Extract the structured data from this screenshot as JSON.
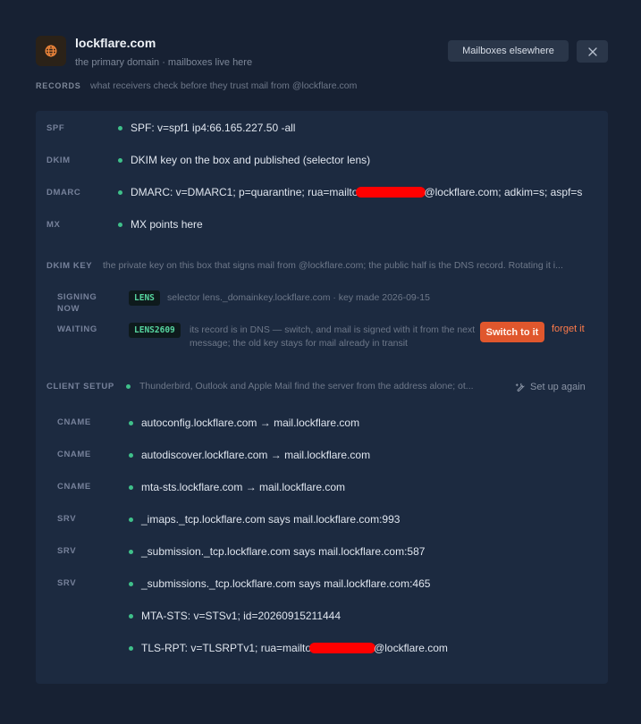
{
  "header": {
    "title": "lockflare.com",
    "subtitle": "the primary domain · mailboxes live here",
    "icon": "globe-icon",
    "elsewhere_button": "Mailboxes elsewhere",
    "close_icon": "close-icon"
  },
  "records": {
    "label": "RECORDS",
    "description": "what receivers check before they trust mail from @lockflare.com",
    "items": [
      {
        "tag": "SPF",
        "value": "SPF: v=spf1 ip4:66.165.227.50 -all",
        "status": "ok"
      },
      {
        "tag": "DKIM",
        "value": "DKIM key on the box and published (selector lens)",
        "status": "ok"
      },
      {
        "tag": "DMARC",
        "value_pre": "DMARC: v=DMARC1; p=quarantine; rua=mailto",
        "value_post": "@lockflare.com; adkim=s; aspf=s",
        "status": "ok"
      },
      {
        "tag": "MX",
        "value": "MX points here",
        "status": "ok"
      }
    ]
  },
  "dkim_key": {
    "label": "DKIM KEY",
    "description": "the private key on this box that signs mail from @lockflare.com; the public half is the DNS record. Rotating it i...",
    "signing": {
      "tag_line1": "SIGNING",
      "tag_line2": "NOW",
      "selector": "LENS",
      "meta": "selector lens._domainkey.lockflare.com · key made 2026-09-15"
    },
    "waiting": {
      "tag": "WAITING",
      "selector": "LENS2609",
      "description": "its record is in DNS — switch, and mail is signed with it from the next message; the old key stays for mail already in transit",
      "switch_button": "Switch to it",
      "forget_link": "forget it"
    }
  },
  "client_setup": {
    "label": "CLIENT SETUP",
    "description": "Thunderbird, Outlook and Apple Mail find the server from the address alone; ot...",
    "setup_button": "Set up again",
    "setup_icon": "wrench-icon",
    "items": [
      {
        "tag": "CNAME",
        "value": "autoconfig.lockflare.com → mail.lockflare.com"
      },
      {
        "tag": "CNAME",
        "value": "autodiscover.lockflare.com → mail.lockflare.com"
      },
      {
        "tag": "CNAME",
        "value": "mta-sts.lockflare.com → mail.lockflare.com"
      },
      {
        "tag": "SRV",
        "value": "_imaps._tcp.lockflare.com says mail.lockflare.com:993"
      },
      {
        "tag": "SRV",
        "value": "_submission._tcp.lockflare.com says mail.lockflare.com:587"
      },
      {
        "tag": "SRV",
        "value": "_submissions._tcp.lockflare.com says mail.lockflare.com:465"
      },
      {
        "tag": "",
        "value": "MTA-STS: v=STSv1; id=20260915211444"
      },
      {
        "tag": "",
        "value_pre": "TLS-RPT: v=TLSRPTv1; rua=mailto",
        "value_post": "@lockflare.com"
      }
    ]
  },
  "colors": {
    "background": "#172133",
    "panel": "#1c2a40",
    "ok_dot": "#3fc08a",
    "accent": "#e0572d",
    "badge_text": "#57d6a0"
  }
}
